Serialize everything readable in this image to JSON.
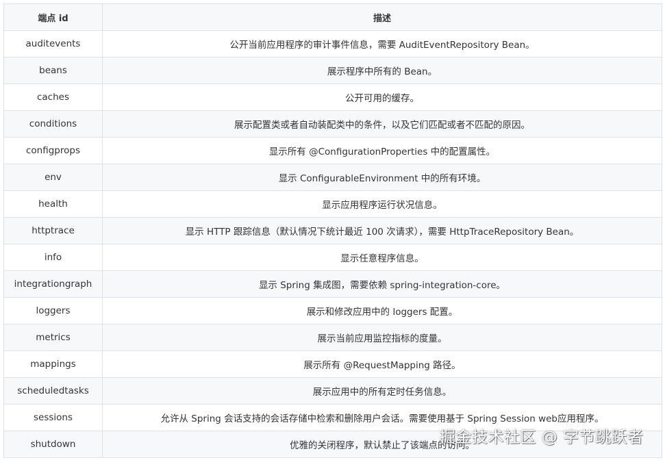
{
  "table": {
    "headers": [
      "端点 id",
      "描述"
    ],
    "rows": [
      {
        "id": "auditevents",
        "desc": "公开当前应用程序的审计事件信息，需要 AuditEventRepository Bean。"
      },
      {
        "id": "beans",
        "desc": "展示程序中所有的 Bean。"
      },
      {
        "id": "caches",
        "desc": "公开可用的缓存。"
      },
      {
        "id": "conditions",
        "desc": "展示配置类或者自动装配类中的条件，以及它们匹配或者不匹配的原因。"
      },
      {
        "id": "configprops",
        "desc": "显示所有 @ConfigurationProperties 中的配置属性。"
      },
      {
        "id": "env",
        "desc": "显示 ConfigurableEnvironment 中的所有环境。"
      },
      {
        "id": "health",
        "desc": "显示应用程序运行状况信息。"
      },
      {
        "id": "httptrace",
        "desc": "显示 HTTP 跟踪信息（默认情况下统计最近 100 次请求），需要 HttpTraceRepository Bean。"
      },
      {
        "id": "info",
        "desc": "显示任意程序信息。"
      },
      {
        "id": "integrationgraph",
        "desc": "显示 Spring 集成图，需要依赖 spring-integration-core。"
      },
      {
        "id": "loggers",
        "desc": "展示和修改应用中的 loggers 配置。"
      },
      {
        "id": "metrics",
        "desc": "展示当前应用监控指标的度量。"
      },
      {
        "id": "mappings",
        "desc": "展示所有 @RequestMapping 路径。"
      },
      {
        "id": "scheduledtasks",
        "desc": "展示应用中的所有定时任务信息。"
      },
      {
        "id": "sessions",
        "desc": "允许从 Spring 会话支持的会话存储中检索和删除用户会话。需要使用基于 Spring Session web应用程序。"
      },
      {
        "id": "shutdown",
        "desc": "优雅的关闭程序，默认禁止了该端点的访问。"
      }
    ]
  },
  "watermark": "掘金技术社区 @ 字节跳跃者"
}
